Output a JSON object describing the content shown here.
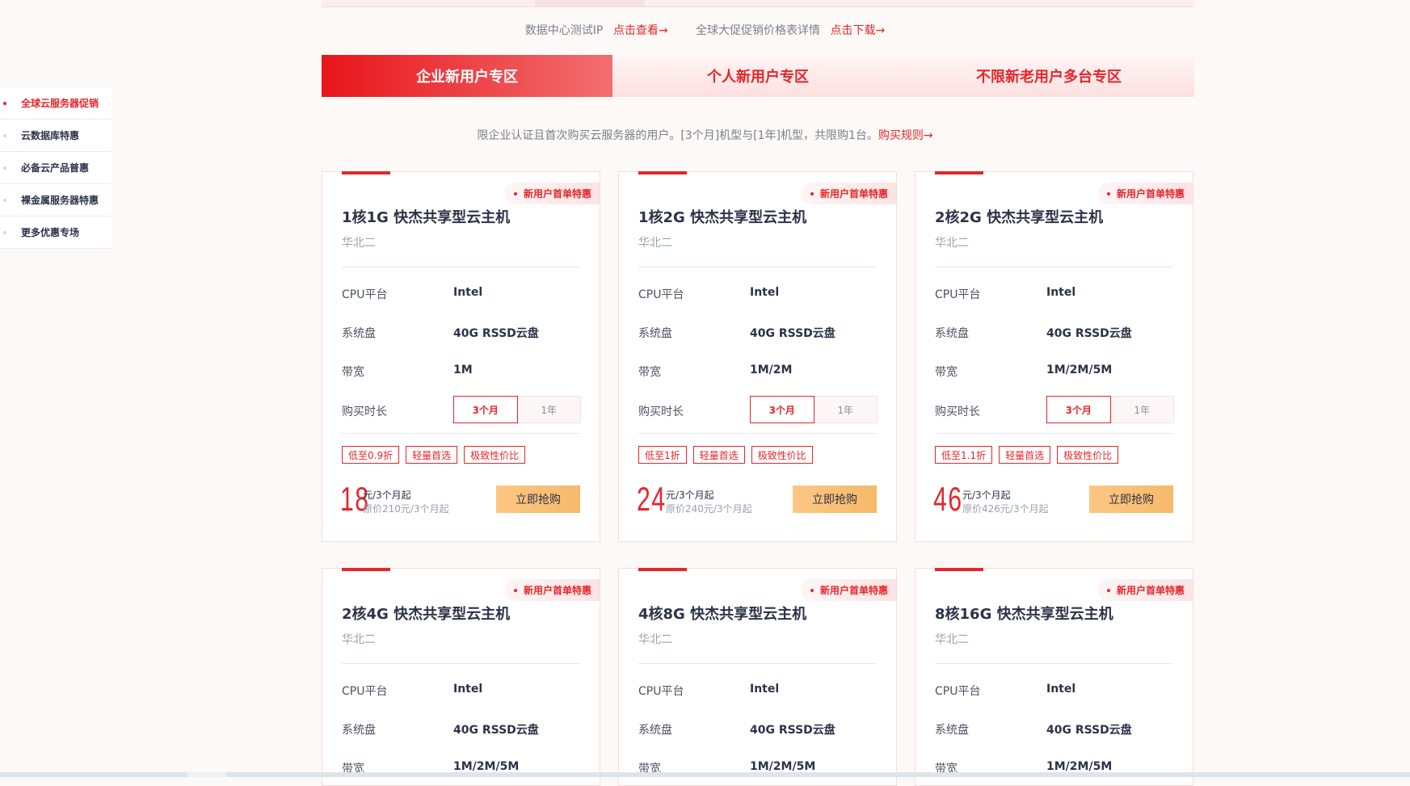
{
  "info_links": {
    "text1": "数据中心测试IP",
    "link1": "点击查看→",
    "text2": "全球大促促销价格表详情",
    "link2": "点击下载→"
  },
  "tabs": [
    {
      "label": "企业新用户专区",
      "active": true
    },
    {
      "label": "个人新用户专区",
      "active": false
    },
    {
      "label": "不限新老用户多台专区",
      "active": false
    }
  ],
  "description": {
    "text": "限企业认证且首次购买云服务器的用户。[3个月]机型与[1年]机型，共限购1台。",
    "link": "购买规则→"
  },
  "sidebar": {
    "items": [
      {
        "label": "全球云服务器促销",
        "active": true
      },
      {
        "label": "云数据库特惠",
        "active": false
      },
      {
        "label": "必备云产品普惠",
        "active": false
      },
      {
        "label": "裸金属服务器特惠",
        "active": false
      },
      {
        "label": "更多优惠专场",
        "active": false
      }
    ]
  },
  "card_labels": {
    "cpu": "CPU平台",
    "disk": "系统盘",
    "bandwidth": "带宽",
    "duration": "购买时长",
    "buy": "立即抢购"
  },
  "products": [
    {
      "badge": "新用户首单特惠",
      "title": "1核1G 快杰共享型云主机",
      "region": "华北二",
      "cpu": "Intel",
      "disk": "40G RSSD云盘",
      "bandwidth": "1M",
      "duration_options": [
        "3个月",
        "1年"
      ],
      "selected_duration": "3个月",
      "tags": [
        "低至0.9折",
        "轻量首选",
        "极致性价比"
      ],
      "price": "18",
      "price_unit": "元/3个月起",
      "original_price": "原价210元/3个月起"
    },
    {
      "badge": "新用户首单特惠",
      "title": "1核2G 快杰共享型云主机",
      "region": "华北二",
      "cpu": "Intel",
      "disk": "40G RSSD云盘",
      "bandwidth": "1M/2M",
      "duration_options": [
        "3个月",
        "1年"
      ],
      "selected_duration": "3个月",
      "tags": [
        "低至1折",
        "轻量首选",
        "极致性价比"
      ],
      "price": "24",
      "price_unit": "元/3个月起",
      "original_price": "原价240元/3个月起"
    },
    {
      "badge": "新用户首单特惠",
      "title": "2核2G 快杰共享型云主机",
      "region": "华北二",
      "cpu": "Intel",
      "disk": "40G RSSD云盘",
      "bandwidth": "1M/2M/5M",
      "duration_options": [
        "3个月",
        "1年"
      ],
      "selected_duration": "3个月",
      "tags": [
        "低至1.1折",
        "轻量首选",
        "极致性价比"
      ],
      "price": "46",
      "price_unit": "元/3个月起",
      "original_price": "原价426元/3个月起"
    },
    {
      "badge": "新用户首单特惠",
      "title": "2核4G 快杰共享型云主机",
      "region": "华北二",
      "cpu": "Intel",
      "disk": "40G RSSD云盘",
      "bandwidth": "1M/2M/5M"
    },
    {
      "badge": "新用户首单特惠",
      "title": "4核8G 快杰共享型云主机",
      "region": "华北二",
      "cpu": "Intel",
      "disk": "40G RSSD云盘",
      "bandwidth": "1M/2M/5M"
    },
    {
      "badge": "新用户首单特惠",
      "title": "8核16G 快杰共享型云主机",
      "region": "华北二",
      "cpu": "Intel",
      "disk": "40G RSSD云盘",
      "bandwidth": "1M/2M/5M"
    }
  ],
  "colors": {
    "accent": "#e5262b",
    "button": "#fdc784",
    "page_bg": "#fdf9f6"
  }
}
